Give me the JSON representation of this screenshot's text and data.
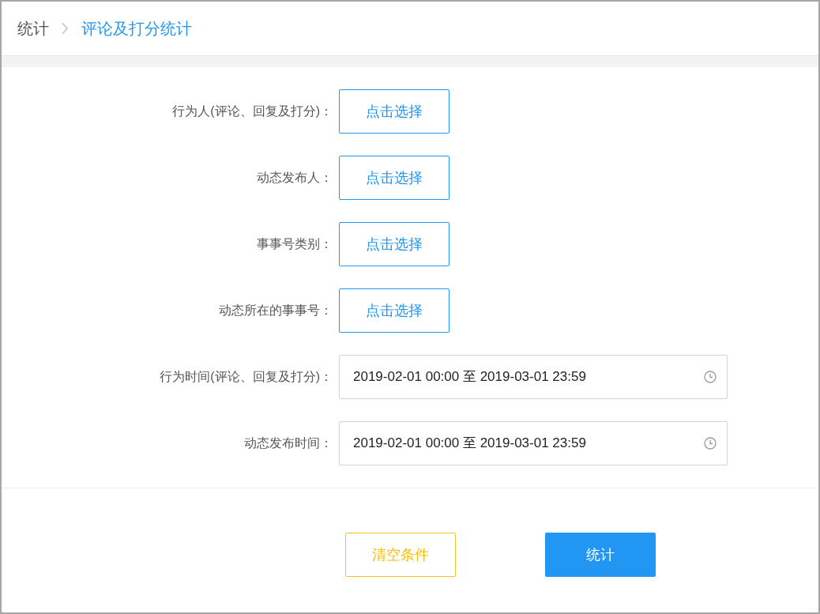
{
  "breadcrumb": [
    {
      "label": "统计",
      "current": false
    },
    {
      "label": "评论及打分统计",
      "current": true
    }
  ],
  "fields": [
    {
      "kind": "picker",
      "label": "行为人(评论、回复及打分)：",
      "button": "点击选择"
    },
    {
      "kind": "picker",
      "label": "动态发布人：",
      "button": "点击选择"
    },
    {
      "kind": "picker",
      "label": "事事号类别：",
      "button": "点击选择"
    },
    {
      "kind": "picker",
      "label": "动态所在的事事号：",
      "button": "点击选择"
    },
    {
      "kind": "daterange",
      "label": "行为时间(评论、回复及打分)：",
      "value": "2019-02-01 00:00 至 2019-03-01 23:59"
    },
    {
      "kind": "daterange",
      "label": "动态发布时间：",
      "value": "2019-02-01 00:00 至 2019-03-01 23:59"
    }
  ],
  "actions": [
    {
      "kind": "secondary",
      "label": "清空条件"
    },
    {
      "kind": "primary",
      "label": "统计"
    }
  ]
}
